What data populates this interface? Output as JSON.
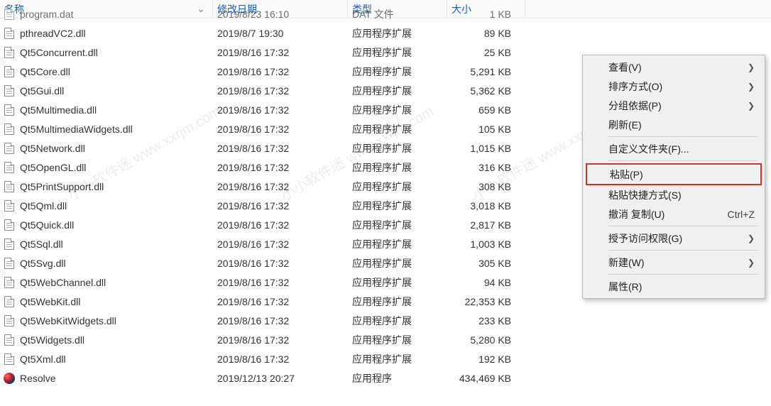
{
  "columns": {
    "name": "名称",
    "date": "修改日期",
    "type": "类型",
    "size": "大小"
  },
  "files": [
    {
      "name": "program.dat",
      "date": "2019/8/23 16:10",
      "type": "DAT 文件",
      "size": "1 KB",
      "icon": "dll"
    },
    {
      "name": "pthreadVC2.dll",
      "date": "2019/8/7 19:30",
      "type": "应用程序扩展",
      "size": "89 KB",
      "icon": "dll"
    },
    {
      "name": "Qt5Concurrent.dll",
      "date": "2019/8/16 17:32",
      "type": "应用程序扩展",
      "size": "25 KB",
      "icon": "dll"
    },
    {
      "name": "Qt5Core.dll",
      "date": "2019/8/16 17:32",
      "type": "应用程序扩展",
      "size": "5,291 KB",
      "icon": "dll"
    },
    {
      "name": "Qt5Gui.dll",
      "date": "2019/8/16 17:32",
      "type": "应用程序扩展",
      "size": "5,362 KB",
      "icon": "dll"
    },
    {
      "name": "Qt5Multimedia.dll",
      "date": "2019/8/16 17:32",
      "type": "应用程序扩展",
      "size": "659 KB",
      "icon": "dll"
    },
    {
      "name": "Qt5MultimediaWidgets.dll",
      "date": "2019/8/16 17:32",
      "type": "应用程序扩展",
      "size": "105 KB",
      "icon": "dll"
    },
    {
      "name": "Qt5Network.dll",
      "date": "2019/8/16 17:32",
      "type": "应用程序扩展",
      "size": "1,015 KB",
      "icon": "dll"
    },
    {
      "name": "Qt5OpenGL.dll",
      "date": "2019/8/16 17:32",
      "type": "应用程序扩展",
      "size": "316 KB",
      "icon": "dll"
    },
    {
      "name": "Qt5PrintSupport.dll",
      "date": "2019/8/16 17:32",
      "type": "应用程序扩展",
      "size": "308 KB",
      "icon": "dll"
    },
    {
      "name": "Qt5Qml.dll",
      "date": "2019/8/16 17:32",
      "type": "应用程序扩展",
      "size": "3,018 KB",
      "icon": "dll"
    },
    {
      "name": "Qt5Quick.dll",
      "date": "2019/8/16 17:32",
      "type": "应用程序扩展",
      "size": "2,817 KB",
      "icon": "dll"
    },
    {
      "name": "Qt5Sql.dll",
      "date": "2019/8/16 17:32",
      "type": "应用程序扩展",
      "size": "1,003 KB",
      "icon": "dll"
    },
    {
      "name": "Qt5Svg.dll",
      "date": "2019/8/16 17:32",
      "type": "应用程序扩展",
      "size": "305 KB",
      "icon": "dll"
    },
    {
      "name": "Qt5WebChannel.dll",
      "date": "2019/8/16 17:32",
      "type": "应用程序扩展",
      "size": "94 KB",
      "icon": "dll"
    },
    {
      "name": "Qt5WebKit.dll",
      "date": "2019/8/16 17:32",
      "type": "应用程序扩展",
      "size": "22,353 KB",
      "icon": "dll"
    },
    {
      "name": "Qt5WebKitWidgets.dll",
      "date": "2019/8/16 17:32",
      "type": "应用程序扩展",
      "size": "233 KB",
      "icon": "dll"
    },
    {
      "name": "Qt5Widgets.dll",
      "date": "2019/8/16 17:32",
      "type": "应用程序扩展",
      "size": "5,280 KB",
      "icon": "dll"
    },
    {
      "name": "Qt5Xml.dll",
      "date": "2019/8/16 17:32",
      "type": "应用程序扩展",
      "size": "192 KB",
      "icon": "dll"
    },
    {
      "name": "Resolve",
      "date": "2019/12/13 20:27",
      "type": "应用程序",
      "size": "434,469 KB",
      "icon": "resolve"
    }
  ],
  "context_menu": {
    "view": "查看(V)",
    "sort": "排序方式(O)",
    "group": "分组依据(P)",
    "refresh": "刷新(E)",
    "customize": "自定义文件夹(F)...",
    "paste": "粘贴(P)",
    "paste_shortcut": "粘贴快捷方式(S)",
    "undo_copy": "撤消 复制(U)",
    "undo_shortcut": "Ctrl+Z",
    "grant_access": "授予访问权限(G)",
    "new": "新建(W)",
    "properties": "属性(R)"
  },
  "watermark_text": "小小软件迷 www.xxrjm.com"
}
